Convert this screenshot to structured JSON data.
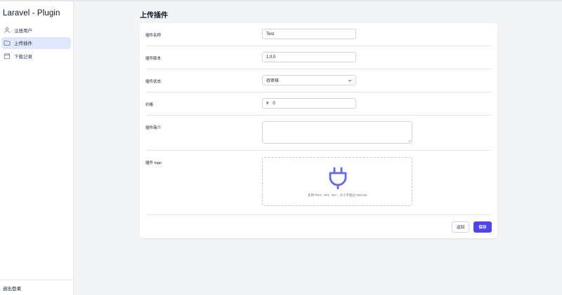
{
  "sidebar": {
    "app_title": "Laravel - Plugin",
    "items": [
      {
        "label": "注册用户",
        "icon": "user-icon",
        "active": false
      },
      {
        "label": "上传插件",
        "icon": "folder-icon",
        "active": true
      },
      {
        "label": "下载记录",
        "icon": "calendar-icon",
        "active": false
      }
    ],
    "logout_label": "退出登录"
  },
  "page": {
    "title": "上传插件"
  },
  "form": {
    "name": {
      "label": "插件名称",
      "value": "Test"
    },
    "version": {
      "label": "插件版本",
      "value": "1.0.0"
    },
    "status": {
      "label": "插件状态",
      "value": "待审核"
    },
    "price": {
      "label": "价格",
      "prefix": "¥",
      "value": "0"
    },
    "intro": {
      "label": "插件简介",
      "value": ""
    },
    "logo": {
      "label": "插件 logo",
      "hint": "支持 PNG, JPG, GIF，大小不超过 500 KB",
      "icon": "plug-icon"
    }
  },
  "actions": {
    "back_label": "返回",
    "save_label": "保存"
  },
  "colors": {
    "accent": "#4f46e5",
    "active_nav_bg": "#e0e7ff",
    "page_bg": "#f3f4f6"
  }
}
